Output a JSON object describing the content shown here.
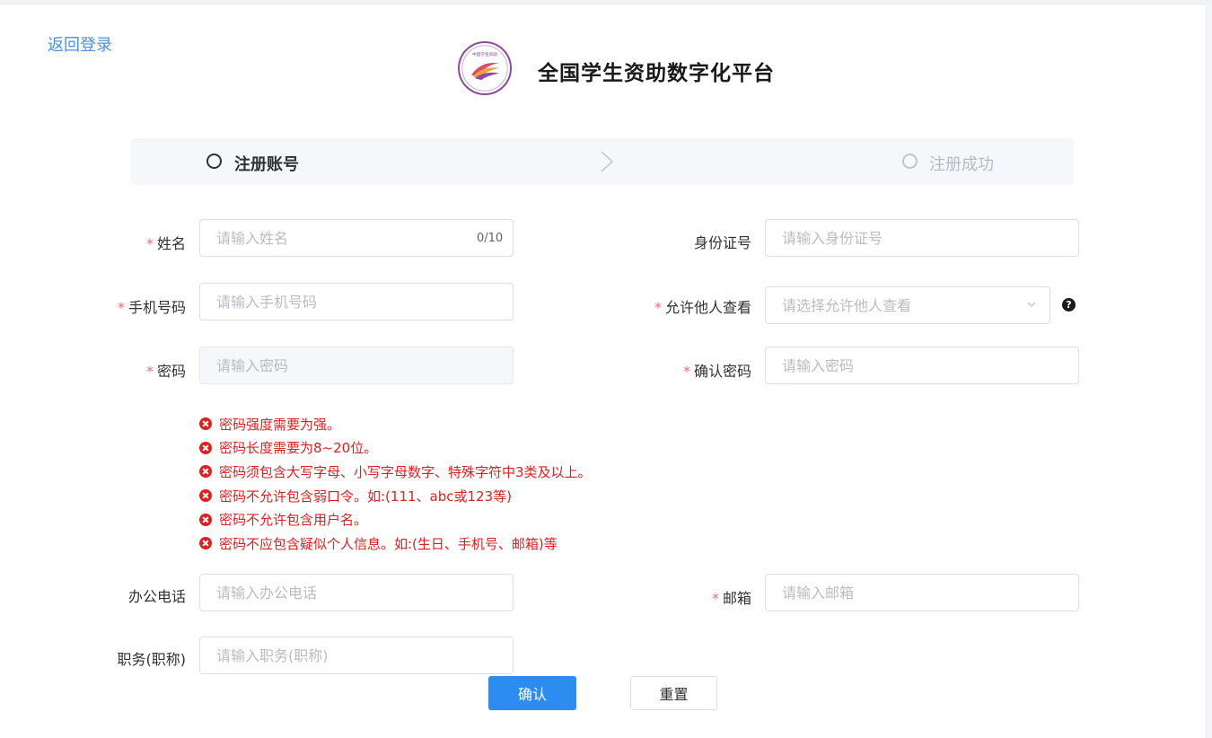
{
  "header": {
    "back_link": "返回登录",
    "platform_title": "全国学生资助数字化平台",
    "logo_text": "中国学生资助"
  },
  "steps": [
    {
      "label": "注册账号",
      "state": "active"
    },
    {
      "label": "注册成功",
      "state": "inactive"
    }
  ],
  "form": {
    "name": {
      "label": "姓名",
      "required": "*",
      "placeholder": "请输入姓名",
      "counter": "0/10"
    },
    "id_number": {
      "label": "身份证号",
      "placeholder": "请输入身份证号"
    },
    "phone": {
      "label": "手机号码",
      "required": "*",
      "placeholder": "请输入手机号码"
    },
    "visibility": {
      "label": "允许他人查看",
      "required": "*",
      "placeholder": "请选择允许他人查看"
    },
    "password": {
      "label": "密码",
      "required": "*",
      "placeholder": "请输入密码"
    },
    "confirm_password": {
      "label": "确认密码",
      "required": "*",
      "placeholder": "请输入密码"
    },
    "office_phone": {
      "label": "办公电话",
      "placeholder": "请输入办公电话"
    },
    "email": {
      "label": "邮箱",
      "required": "*",
      "placeholder": "请输入邮箱"
    },
    "position": {
      "label": "职务(职称)",
      "placeholder": "请输入职务(职称)"
    }
  },
  "password_errors": [
    "密码强度需要为强。",
    "密码长度需要为8~20位。",
    "密码须包含大写字母、小写字母数字、特殊字符中3类及以上。",
    "密码不允许包含弱口令。如:(111、abc或123等)",
    "密码不允许包含用户名。",
    "密码不应包含疑似个人信息。如:(生日、手机号、邮箱)等"
  ],
  "buttons": {
    "confirm": "确认",
    "reset": "重置"
  },
  "colors": {
    "primary": "#2d8cf0",
    "error": "#e02020",
    "required": "#f56c6c",
    "link": "#4a90e2"
  },
  "icons": {
    "help": "question-circle-icon",
    "error": "close-circle-icon",
    "select": "chevron-down-icon"
  }
}
